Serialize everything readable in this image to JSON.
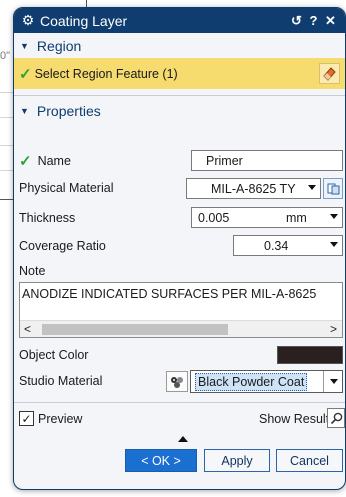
{
  "background": {
    "fragment_text": "0\""
  },
  "dialog": {
    "title": "Coating Layer",
    "titlebar_buttons": {
      "reset": "↺",
      "help": "?",
      "close": "✕"
    },
    "region": {
      "header": "Region",
      "select_label": "Select Region Feature (1)"
    },
    "properties": {
      "header": "Properties",
      "name_label": "Name",
      "name_value": "Primer",
      "physical_material_label": "Physical Material",
      "physical_material_value": "MIL-A-8625 TY",
      "thickness_label": "Thickness",
      "thickness_value": "0.005",
      "thickness_unit": "mm",
      "coverage_label": "Coverage Ratio",
      "coverage_value": "0.34",
      "note_label": "Note",
      "note_text": "ANODIZE INDICATED SURFACES PER MIL-A-8625",
      "object_color_label": "Object Color",
      "object_color_value": "#2a2020",
      "studio_material_label": "Studio Material",
      "studio_material_value": "Black Powder Coat"
    },
    "footer": {
      "preview_label": "Preview",
      "preview_checked": true,
      "show_result_label": "Show Result",
      "ok_label": "< OK >",
      "apply_label": "Apply",
      "cancel_label": "Cancel"
    }
  },
  "colors": {
    "titlebar": "#0f3d70",
    "highlight": "#f6db6e",
    "primary_button": "#1a6fd0"
  }
}
